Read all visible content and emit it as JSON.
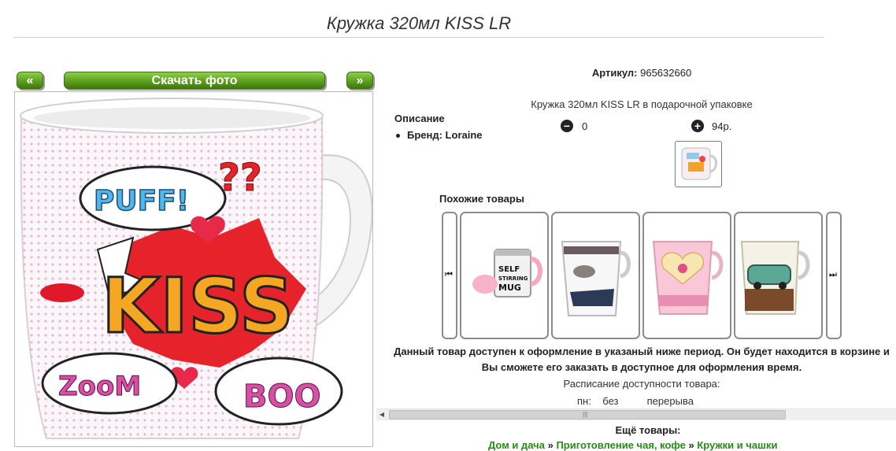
{
  "page": {
    "title": "Кружка 320мл KISS LR"
  },
  "gallery": {
    "prev_label": "«",
    "download_label": "Скачать фото",
    "next_label": "»",
    "mug_texts": {
      "puff": "PUFF!",
      "kiss": "KISS",
      "zoom": "ZooM",
      "boom": "BOO",
      "qmarks": "??"
    }
  },
  "product": {
    "sku_label": "Артикул:",
    "sku_value": "965632660",
    "full_name": "Кружка 320мл KISS LR в подарочной упаковке",
    "description_heading": "Описание",
    "brand_text": "Бренд: Loraine",
    "quantity": "0",
    "price": "94р."
  },
  "similar": {
    "heading": "Похожие товары",
    "items": [
      {
        "name": "self-stirring-mug",
        "label": "SELF STIRRING MUG"
      },
      {
        "name": "fashion-mug"
      },
      {
        "name": "pink-flower-mug"
      },
      {
        "name": "car-cafe-mug"
      }
    ]
  },
  "availability": {
    "note": "Данный товар доступен к оформление в указаный ниже период. Он будет находится в корзине и Вы сможете его заказать в доступное для оформления время.",
    "schedule_title": "Расписание доступности товара:",
    "schedule_day": "пн:",
    "schedule_from": "без",
    "schedule_to": "перерыва"
  },
  "more": {
    "heading": "Ещё товары:",
    "breadcrumb": [
      "Дом и дача",
      "Приготовление чая, кофе",
      "Кружки и чашки"
    ],
    "separator": "»"
  },
  "colors": {
    "accent_green": "#5ea01f",
    "link_green": "#2a8a1a"
  }
}
